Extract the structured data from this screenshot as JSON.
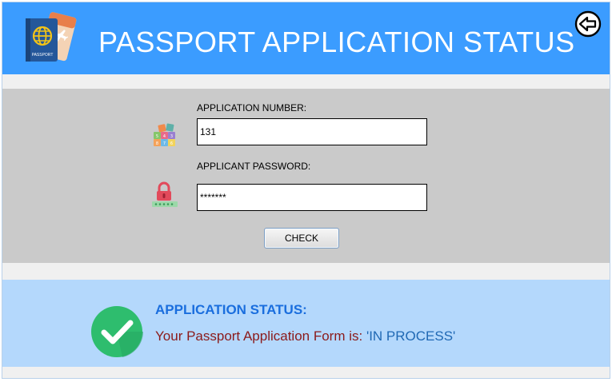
{
  "header": {
    "title": "PASSPORT APPLICATION STATUS",
    "logo_icon": "passport-icon",
    "logo_text": "PASSPORT",
    "back_icon": "arrow-left-circle-icon"
  },
  "form": {
    "application_number": {
      "label": "APPLICATION NUMBER:",
      "value": "131",
      "icon": "number-blocks-icon"
    },
    "applicant_password": {
      "label": "APPLICANT PASSWORD:",
      "value": "*******",
      "icon": "padlock-icon"
    },
    "check_label": "CHECK"
  },
  "status": {
    "heading": "APPLICATION STATUS:",
    "message_prefix": "Your Passport Application Form is: ",
    "message_value": "'IN PROCESS'",
    "icon": "check-circle-icon"
  },
  "colors": {
    "header_bg": "#3b9cff",
    "form_panel_bg": "#cacaca",
    "status_panel_bg": "#b4d8fc",
    "status_heading": "#1a6ede",
    "status_prefix": "#8b1a1a",
    "status_value": "#1f68b4",
    "success_green": "#2ebd6e"
  }
}
